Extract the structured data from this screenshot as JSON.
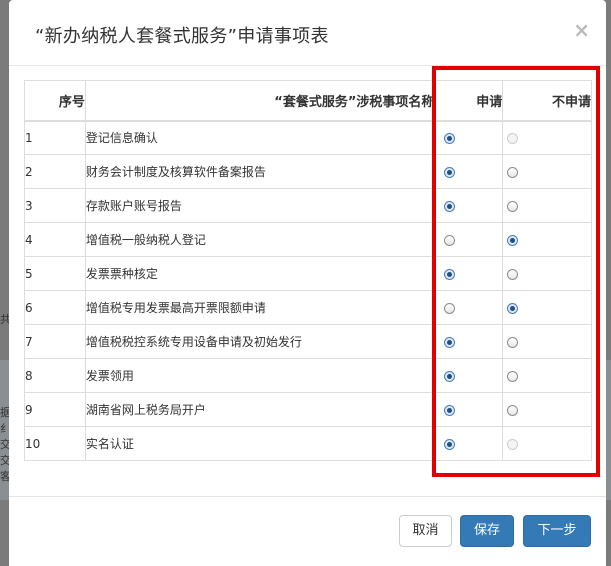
{
  "dialog": {
    "title": "“新办纳税人套餐式服务”申请事项表",
    "close_glyph": "×"
  },
  "table": {
    "headers": {
      "no": "序号",
      "name": "“套餐式服务”涉税事项名称",
      "apply": "申请",
      "no_apply": "不申请"
    },
    "rows": [
      {
        "no": "1",
        "name": "登记信息确认",
        "apply_checked": true,
        "noapply_checked": false,
        "noapply_disabled": true
      },
      {
        "no": "2",
        "name": "财务会计制度及核算软件备案报告",
        "apply_checked": true,
        "noapply_checked": false,
        "noapply_disabled": false
      },
      {
        "no": "3",
        "name": "存款账户账号报告",
        "apply_checked": true,
        "noapply_checked": false,
        "noapply_disabled": false
      },
      {
        "no": "4",
        "name": "增值税一般纳税人登记",
        "apply_checked": false,
        "noapply_checked": true,
        "noapply_disabled": false
      },
      {
        "no": "5",
        "name": "发票票种核定",
        "apply_checked": true,
        "noapply_checked": false,
        "noapply_disabled": false
      },
      {
        "no": "6",
        "name": "增值税专用发票最高开票限额申请",
        "apply_checked": false,
        "noapply_checked": true,
        "noapply_disabled": false
      },
      {
        "no": "7",
        "name": "增值税税控系统专用设备申请及初始发行",
        "apply_checked": true,
        "noapply_checked": false,
        "noapply_disabled": false
      },
      {
        "no": "8",
        "name": "发票领用",
        "apply_checked": true,
        "noapply_checked": false,
        "noapply_disabled": false
      },
      {
        "no": "9",
        "name": "湖南省网上税务局开户",
        "apply_checked": true,
        "noapply_checked": false,
        "noapply_disabled": false
      },
      {
        "no": "10",
        "name": "实名认证",
        "apply_checked": true,
        "noapply_checked": false,
        "noapply_disabled": true
      }
    ]
  },
  "footer": {
    "cancel_label": "取消",
    "save_label": "保存",
    "next_label": "下一步"
  },
  "background": {
    "left_glyphs": [
      "共",
      "据",
      "纟",
      "交",
      "交",
      "客"
    ]
  },
  "colors": {
    "highlight": "#e30000",
    "primary": "#337ab7"
  }
}
